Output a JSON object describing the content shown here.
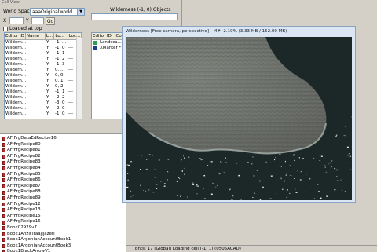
{
  "left_panel": {
    "title_fragment": "Cell View",
    "world_space_label": "World Space",
    "world_space_value": "aaaOriginalworld",
    "x_label": "X",
    "y_label": "Y",
    "go_label": "Go",
    "loaded_at_top_label": "Loaded at top",
    "objects_title": "Wilderness (-1, 0) Objects",
    "cells_columns": [
      "Editor ID",
      "Name",
      "L...",
      "Lo...",
      "Loc..."
    ],
    "cells_rows": [
      [
        "Wildern...",
        "",
        "Y",
        "-1, ...",
        "---"
      ],
      [
        "Wildern...",
        "",
        "Y",
        "-1, 0",
        "---"
      ],
      [
        "Wildern...",
        "",
        "Y",
        "-1, 1",
        "---"
      ],
      [
        "Wildern...",
        "",
        "Y",
        "-1, 2",
        "---"
      ],
      [
        "Wildern...",
        "",
        "Y",
        "-1, 3",
        "---"
      ],
      [
        "Wildern...",
        "",
        "Y",
        "0, ...",
        "---"
      ],
      [
        "Wildern...",
        "",
        "Y",
        "0, 0",
        "---"
      ],
      [
        "Wildern...",
        "",
        "Y",
        "0, 1",
        "---"
      ],
      [
        "Wildern...",
        "",
        "Y",
        "0, 2",
        "---"
      ],
      [
        "Wildern...",
        "",
        "Y",
        "-1, 1",
        "---"
      ],
      [
        "Wildern...",
        "",
        "Y",
        "-2, 2",
        "---"
      ],
      [
        "Wildern...",
        "",
        "Y",
        "-3, 0",
        "---"
      ],
      [
        "Wildern...",
        "",
        "Y",
        "-2, 0",
        "---"
      ],
      [
        "Wildern...",
        "",
        "Y",
        "-1, 0",
        "---"
      ]
    ],
    "objects_columns": [
      "Editor ID",
      "Co..."
    ],
    "objects_rows": [
      {
        "icon_color": "#2e9d52",
        "label": "Landsca..."
      },
      {
        "icon_color": "#1a3f8f",
        "label": "XMarker *"
      }
    ]
  },
  "object_list": [
    "AFrFrgDataEdRecipe16",
    "AFrFrgRecipe80",
    "AFrFrgRecipe81",
    "AFrFrgRecipe82",
    "AFrFrgRecipe83",
    "AFrFrgRecipe84",
    "AFrFrgRecipe85",
    "AFrFrgRecipe86",
    "AFrFrgRecipe87",
    "AFrFrgRecipe88",
    "AFrFrgRecipe89",
    "AFrFrgRecipe12",
    "AFrFrgRecipe13",
    "AFrFrgRecipe15",
    "AFrFrgRecipe16",
    "Book02929v7",
    "Book1AhzirTraajijazeri",
    "Book1ArgonianAccountBook1",
    "Book1ArgonianAccountBook3",
    "Book1BlackArrowV1"
  ],
  "render_window": {
    "title": "Wilderness [Free camera, perspective] - M#: 2.19% (3.33 MB / 152.00 MB)",
    "status_text": "pnts: 17 [Global] Loading cell (-1, 1) (0505ACAD)",
    "colors": {
      "water": "#1e2a2a",
      "land": "#7b7f79",
      "titlebar": "#dbe6f2"
    }
  }
}
